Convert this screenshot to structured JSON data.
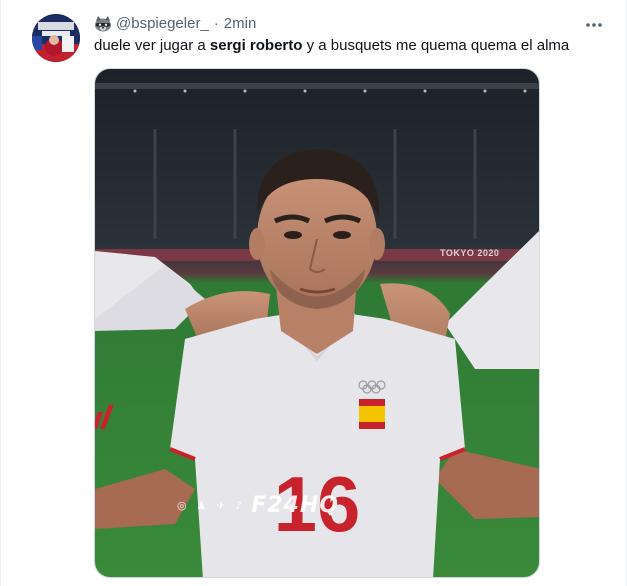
{
  "tweet": {
    "username": "@bspiegeler_",
    "separator": "·",
    "time": "2min",
    "text_before": "duele ver jugar a ",
    "text_bold": "sergi roberto",
    "text_after": " y a busquets me quema quema el alma",
    "more_icon": "ellipsis-icon",
    "user_emoji_icon": "raccoon-icon"
  },
  "media": {
    "jersey_number": "16",
    "watermark": "F24HQ",
    "watermark_icons": "◎ ♟ ✈ ♪",
    "stadium_text": "TOKYO 2020"
  },
  "colors": {
    "text_primary": "#0f1419",
    "text_secondary": "#536471",
    "border": "#cfd9de",
    "pitch_green": "#3f8a3a",
    "jersey_white": "#e6e6ea",
    "number_red": "#c8232c"
  }
}
